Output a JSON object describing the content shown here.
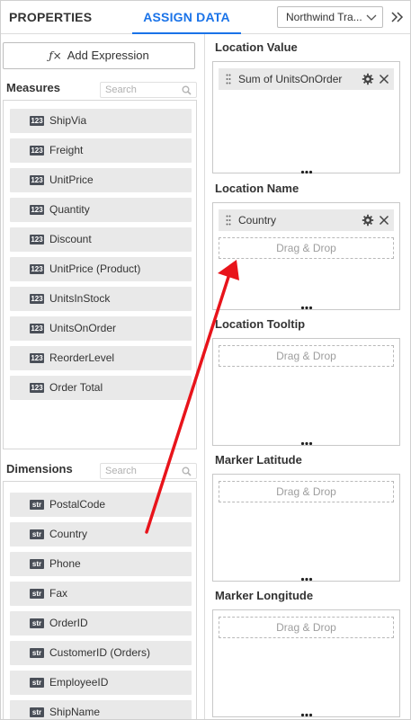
{
  "header": {
    "tabs": [
      {
        "label": "PROPERTIES",
        "active": false
      },
      {
        "label": "ASSIGN DATA",
        "active": true
      }
    ],
    "datasource": "Northwind Tra...",
    "collapse_icon": "double-chevron-right-icon"
  },
  "left": {
    "add_expression_label": "Add Expression",
    "add_expression_icon": "function-fx-icon",
    "measures": {
      "label": "Measures",
      "search_placeholder": "Search",
      "items": [
        {
          "type": "123",
          "label": "ShipVia"
        },
        {
          "type": "123",
          "label": "Freight"
        },
        {
          "type": "123",
          "label": "UnitPrice"
        },
        {
          "type": "123",
          "label": "Quantity"
        },
        {
          "type": "123",
          "label": "Discount"
        },
        {
          "type": "123",
          "label": "UnitPrice (Product)"
        },
        {
          "type": "123",
          "label": "UnitsInStock"
        },
        {
          "type": "123",
          "label": "UnitsOnOrder"
        },
        {
          "type": "123",
          "label": "ReorderLevel"
        },
        {
          "type": "123",
          "label": "Order Total"
        }
      ]
    },
    "dimensions": {
      "label": "Dimensions",
      "search_placeholder": "Search",
      "items": [
        {
          "type": "str",
          "label": "PostalCode"
        },
        {
          "type": "str",
          "label": "Country"
        },
        {
          "type": "str",
          "label": "Phone"
        },
        {
          "type": "str",
          "label": "Fax"
        },
        {
          "type": "str",
          "label": "OrderID"
        },
        {
          "type": "str",
          "label": "CustomerID (Orders)"
        },
        {
          "type": "str",
          "label": "EmployeeID"
        },
        {
          "type": "str",
          "label": "ShipName"
        }
      ]
    }
  },
  "right": {
    "drag_drop_text": "Drag & Drop",
    "zones": [
      {
        "label": "Location Value",
        "pill": "Sum of UnitsOnOrder",
        "show_drop": false
      },
      {
        "label": "Location Name",
        "pill": "Country",
        "show_drop": true
      },
      {
        "label": "Location Tooltip",
        "pill": null,
        "show_drop": true
      },
      {
        "label": "Marker Latitude",
        "pill": null,
        "show_drop": true
      },
      {
        "label": "Marker Longitude",
        "pill": null,
        "show_drop": true
      }
    ]
  },
  "colors": {
    "accent": "#1a73e8",
    "annotation_arrow": "#e8141b",
    "field_bg": "#e9e9e9",
    "badge_bg": "#4a4f58"
  }
}
